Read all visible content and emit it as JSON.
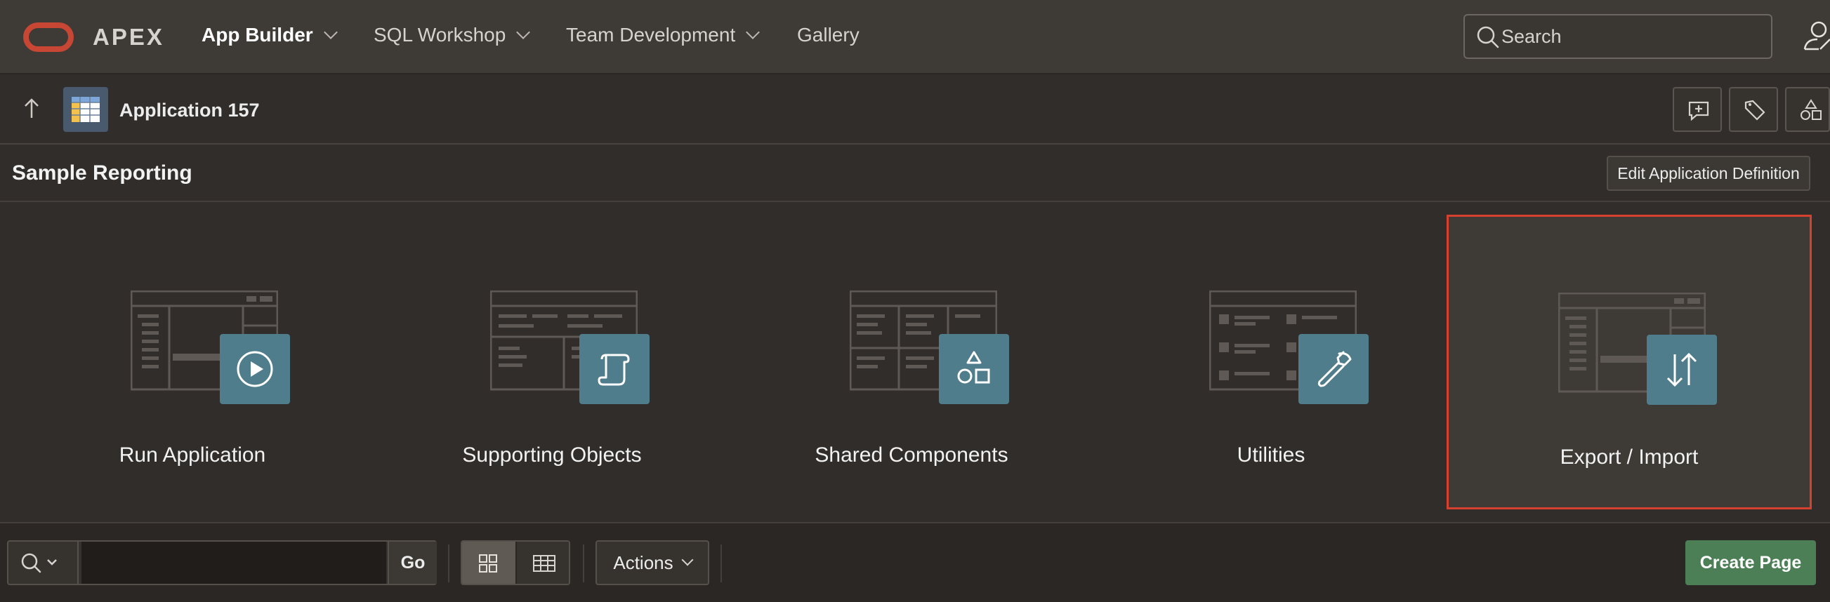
{
  "header": {
    "brand": "APEX",
    "nav": [
      {
        "label": "App Builder",
        "active": true,
        "has_menu": true
      },
      {
        "label": "SQL Workshop",
        "active": false,
        "has_menu": true
      },
      {
        "label": "Team Development",
        "active": false,
        "has_menu": true
      },
      {
        "label": "Gallery",
        "active": false,
        "has_menu": false
      }
    ],
    "search_placeholder": "Search"
  },
  "appbar": {
    "app_title": "Application 157"
  },
  "region": {
    "title": "Sample Reporting",
    "edit_button": "Edit Application Definition"
  },
  "cards": [
    {
      "label": "Run Application",
      "icon": "play-icon",
      "selected": false
    },
    {
      "label": "Supporting Objects",
      "icon": "scroll-icon",
      "selected": false
    },
    {
      "label": "Shared Components",
      "icon": "shapes-icon",
      "selected": false
    },
    {
      "label": "Utilities",
      "icon": "wrench-icon",
      "selected": false
    },
    {
      "label": "Export / Import",
      "icon": "export-import-arrows-icon",
      "selected": true
    }
  ],
  "toolbar": {
    "search_value": "",
    "go_label": "Go",
    "actions_label": "Actions",
    "view_mode": "icons",
    "create_label": "Create Page"
  },
  "colors": {
    "header_bg": "#3e3a36",
    "body_bg": "#312d2a",
    "badge": "#4f7d8c",
    "selection_border": "#d5412e",
    "create_button": "#4c7f56",
    "oracle_red": "#c74634"
  }
}
